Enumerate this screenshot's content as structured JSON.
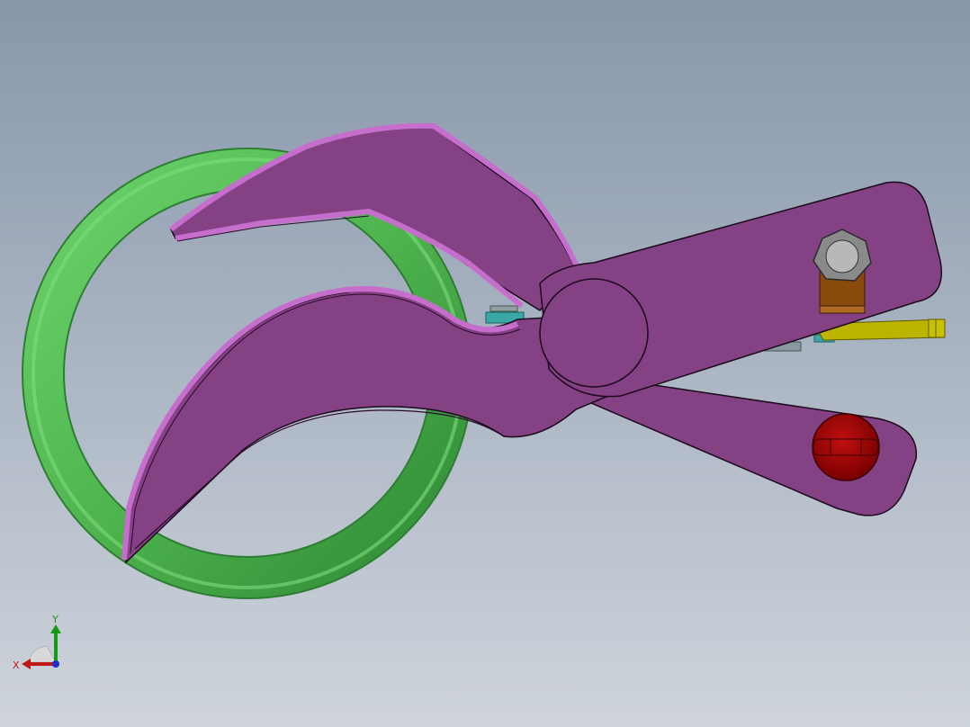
{
  "viewport": {
    "background_top": "#8797aa",
    "background_bottom": "#cfd4db"
  },
  "model": {
    "parts": [
      {
        "name": "ring",
        "color": "#4fb44f"
      },
      {
        "name": "upper-jaw",
        "color": "#844184"
      },
      {
        "name": "lower-jaw-handle",
        "color": "#844184"
      },
      {
        "name": "pivot",
        "color": "#844184"
      },
      {
        "name": "hex-nut",
        "color": "#8a8a8a"
      },
      {
        "name": "bracket",
        "color": "#8a4a0c"
      },
      {
        "name": "red-knob",
        "color": "#9b0000"
      },
      {
        "name": "spring-rod",
        "color": "#c8c200"
      }
    ],
    "edge_highlight": "#c66ecc"
  },
  "triad": {
    "x_label": "X",
    "y_label": "Y",
    "x_color": "#c01818",
    "y_color": "#159a15",
    "z_color": "#1830c8"
  }
}
